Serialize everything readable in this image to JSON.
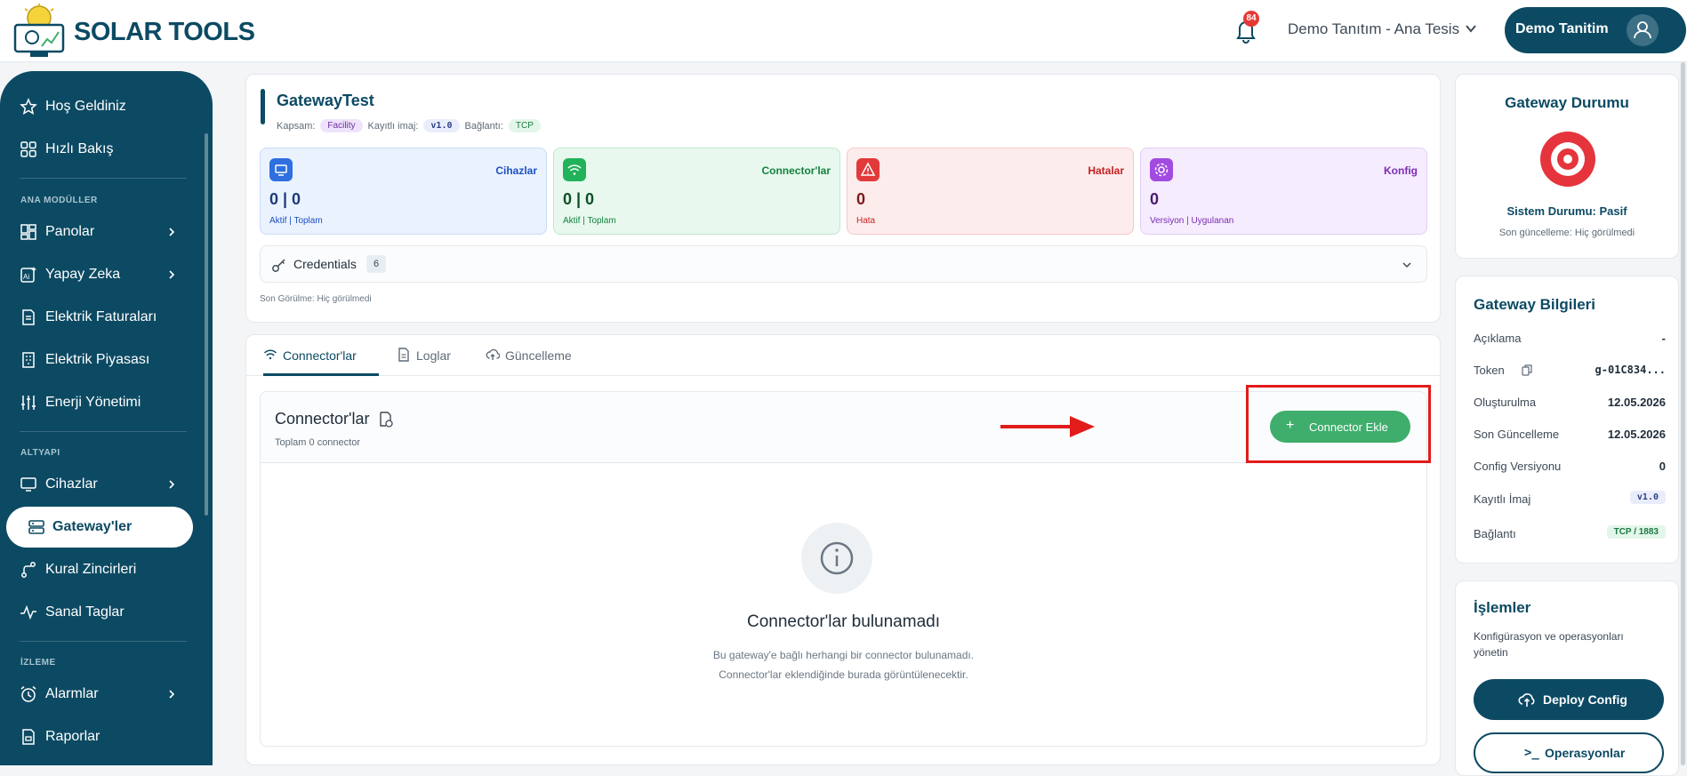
{
  "header": {
    "brand": "SOLAR TOOLS",
    "notification_count": "84",
    "facility": "Demo Tanıtım - Ana Tesis",
    "user_name": "Demo Tanitim"
  },
  "sidebar": {
    "items_top": [
      {
        "label": "Hoş Geldiniz",
        "icon": "star-icon"
      },
      {
        "label": "Hızlı Bakış",
        "icon": "grid-icon"
      }
    ],
    "section_main": "ANA MODÜLLER",
    "items_main": [
      {
        "label": "Panolar",
        "icon": "dashboard-icon"
      },
      {
        "label": "Yapay Zeka",
        "icon": "ai-icon"
      },
      {
        "label": "Elektrik Faturaları",
        "icon": "invoice-icon"
      },
      {
        "label": "Elektrik Piyasası",
        "icon": "building-icon"
      },
      {
        "label": "Enerji Yönetimi",
        "icon": "sliders-icon"
      }
    ],
    "section_infra": "ALTYAPI",
    "items_infra": [
      {
        "label": "Cihazlar",
        "icon": "monitor-icon"
      },
      {
        "label": "Gateway'ler",
        "icon": "server-icon"
      },
      {
        "label": "Kural Zincirleri",
        "icon": "chain-icon"
      },
      {
        "label": "Sanal Taglar",
        "icon": "pulse-icon"
      }
    ],
    "section_monitor": "İZLEME",
    "items_monitor": [
      {
        "label": "Alarmlar",
        "icon": "alarm-clock-icon"
      },
      {
        "label": "Raporlar",
        "icon": "report-icon"
      }
    ]
  },
  "gateway": {
    "title": "GatewayTest",
    "scope_label": "Kapsam:",
    "scope_value": "Facility",
    "image_label": "Kayıtlı imaj:",
    "image_value": "v1.0",
    "conn_label": "Bağlantı:",
    "conn_value": "TCP",
    "stats": [
      {
        "name": "Cihazlar",
        "value": "0 | 0",
        "sub1": "Aktif",
        "sub2": "Toplam",
        "color": "#1d4fc4",
        "bg": "#eaf2fd"
      },
      {
        "name": "Connector'lar",
        "value": "0 | 0",
        "sub1": "Aktif",
        "sub2": "Toplam",
        "color": "#14833f",
        "bg": "#e8f8ee"
      },
      {
        "name": "Hatalar",
        "value": "0",
        "sub1": "Hata",
        "sub2": "",
        "color": "#c62222",
        "bg": "#fdecec"
      },
      {
        "name": "Konfig",
        "value": "0",
        "sub1": "Versiyon",
        "sub2": "Uygulanan",
        "color": "#7b2bb5",
        "bg": "#f5ecfd"
      }
    ],
    "credentials_label": "Credentials",
    "credentials_count": "6",
    "last_seen": "Son Görülme: Hiç görülmedi"
  },
  "tabs": [
    {
      "label": "Connector'lar"
    },
    {
      "label": "Loglar"
    },
    {
      "label": "Güncelleme"
    }
  ],
  "connectors": {
    "title": "Connector'lar",
    "subtitle": "Toplam 0 connector",
    "add_button": "Connector Ekle",
    "empty_title": "Connector'lar bulunamadı",
    "empty_desc1": "Bu gateway'e bağlı herhangi bir connector bulunamadı.",
    "empty_desc2": "Connector'lar eklendiğinde burada görüntülenecektir."
  },
  "status_card": {
    "title": "Gateway Durumu",
    "status": "Sistem Durumu: Pasif",
    "updated": "Son güncelleme: Hiç görülmedi"
  },
  "info_card": {
    "title": "Gateway Bilgileri",
    "rows": [
      {
        "k": "Açıklama",
        "v": "-"
      },
      {
        "k": "Token",
        "v": "g-01C834..."
      },
      {
        "k": "Oluşturulma",
        "v": "12.05.2026"
      },
      {
        "k": "Son Güncelleme",
        "v": "12.05.2026"
      },
      {
        "k": "Config Versiyonu",
        "v": "0"
      },
      {
        "k": "Kayıtlı İmaj",
        "v": "v1.0"
      },
      {
        "k": "Bağlantı",
        "v": "TCP / 1883"
      }
    ]
  },
  "ops_card": {
    "title": "İşlemler",
    "desc": "Konfigürasyon ve operasyonları yönetin",
    "deploy": "Deploy Config",
    "ops": "Operasyonlar"
  },
  "colors": {
    "primary": "#0c4a63",
    "accent_green": "#3fae6c",
    "annotation_red": "#e21b1b"
  }
}
